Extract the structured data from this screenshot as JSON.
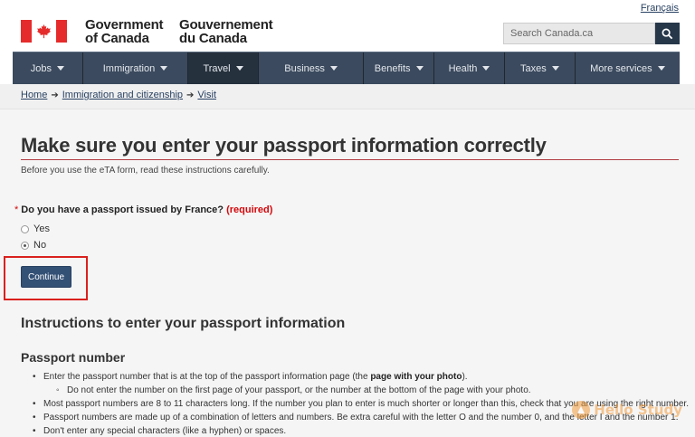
{
  "header": {
    "language_toggle": "Français",
    "wordmark_en": [
      "Government",
      "of Canada"
    ],
    "wordmark_fr": [
      "Gouvernement",
      "du Canada"
    ],
    "search_placeholder": "Search Canada.ca",
    "search_icon": "search-icon"
  },
  "menu": {
    "items": [
      {
        "label": "Jobs",
        "active": false
      },
      {
        "label": "Immigration",
        "active": false
      },
      {
        "label": "Travel",
        "active": true
      },
      {
        "label": "Business",
        "active": false
      },
      {
        "label": "Benefits",
        "active": false
      },
      {
        "label": "Health",
        "active": false
      },
      {
        "label": "Taxes",
        "active": false
      },
      {
        "label": "More services",
        "active": false
      }
    ]
  },
  "breadcrumb": [
    "Home",
    "Immigration and citizenship",
    "Visit"
  ],
  "page": {
    "title": "Make sure you enter your passport information correctly",
    "intro": "Before you use the eTA form, read these instructions carefully."
  },
  "form": {
    "question": "Do you have a passport issued by France?",
    "required_label": "(required)",
    "options": [
      {
        "label": "Yes",
        "selected": false
      },
      {
        "label": "No",
        "selected": true
      }
    ],
    "continue_label": "Continue"
  },
  "instructions": {
    "heading": "Instructions to enter your passport information",
    "subheading": "Passport number",
    "bullet1_before": "Enter the passport number that is at the top of the passport information page (the ",
    "bullet1_bold": "page with your photo",
    "bullet1_after": ").",
    "sub_bullet": "Do not enter the number on the first page of your passport, or the number at the bottom of the page with your photo.",
    "bullet2": "Most passport numbers are 8 to 11 characters long. If the number you plan to enter is much shorter or longer than this, check that you are using the right number.",
    "bullet3": "Passport numbers are made up of a combination of letters and numbers. Be extra careful with the letter O and the number 0, and the letter I and the number 1.",
    "bullet4": "Don't enter any special characters (like a hyphen) or spaces."
  },
  "watermark": "Hello Study",
  "colors": {
    "flag_red": "#e52b2b",
    "menu_bg": "#3b4a5e",
    "menu_active": "#26313e",
    "button_blue": "#335075",
    "required_red": "#d3080c",
    "highlight_red": "#d9211e"
  }
}
